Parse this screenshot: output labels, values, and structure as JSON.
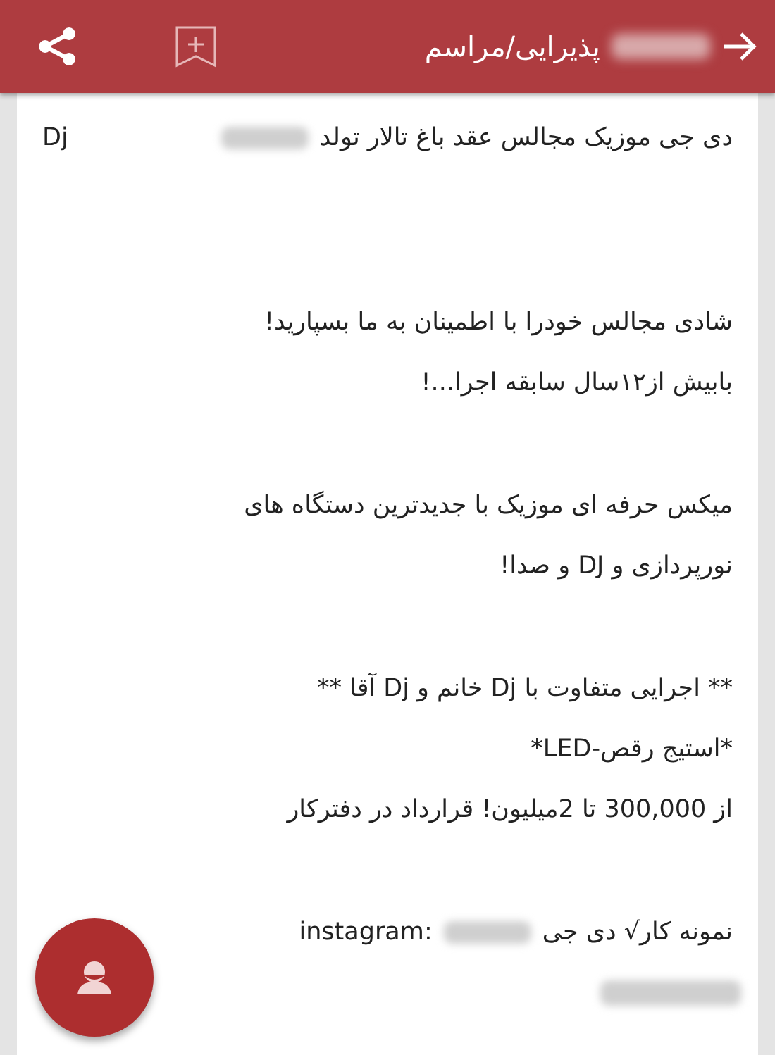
{
  "header": {
    "title": "پذیرایی/مراسم",
    "title_blurred": true
  },
  "post": {
    "paragraphs": [
      {
        "kind": "title",
        "lines": [
          {
            "parts": [
              {
                "kind": "text",
                "text": "دی جی موزیک مجالس عقد باغ تالار تولد"
              },
              {
                "kind": "blur"
              },
              {
                "kind": "latin",
                "text": "Dj"
              }
            ]
          }
        ]
      },
      {
        "kind": "body",
        "lines": [
          {
            "parts": [
              {
                "kind": "text",
                "text": "شادی مجالس خودرا با اطمینان به ما بسپارید!"
              }
            ]
          },
          {
            "parts": [
              {
                "kind": "text",
                "text": "بابیش از۱۲سال سابقه اجرا...!"
              }
            ]
          }
        ]
      },
      {
        "kind": "body",
        "lines": [
          {
            "parts": [
              {
                "kind": "text",
                "text": "میکس حرفه ای موزیک با جدیدترین دستگاه های"
              }
            ]
          },
          {
            "parts": [
              {
                "kind": "text",
                "text": "نورپردازی و DJ و صدا!"
              }
            ]
          }
        ]
      },
      {
        "kind": "body",
        "lines": [
          {
            "parts": [
              {
                "kind": "text",
                "text": "** اجرایی متفاوت با Dj خانم و Dj آقا **"
              }
            ]
          },
          {
            "parts": [
              {
                "kind": "text",
                "text": "*استیج رقص-LED*"
              }
            ]
          },
          {
            "parts": [
              {
                "kind": "text",
                "text": "از 300,000 تا 2میلیون! قرارداد در دفترکار"
              }
            ]
          }
        ]
      },
      {
        "kind": "body",
        "lines": [
          {
            "parts": [
              {
                "kind": "text",
                "text": "نمونه کار√ دی جی"
              },
              {
                "kind": "blur"
              },
              {
                "kind": "latin",
                "text": "instagram:"
              }
            ]
          },
          {
            "parts": [
              {
                "kind": "blur_long"
              }
            ]
          }
        ]
      }
    ]
  }
}
